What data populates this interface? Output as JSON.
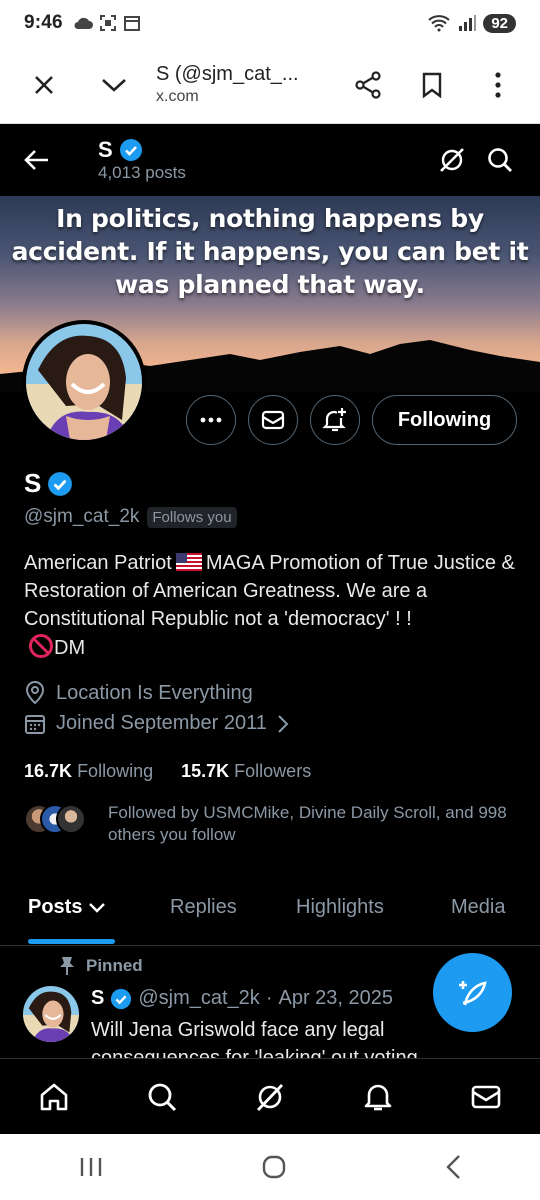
{
  "status_bar": {
    "time": "9:46",
    "battery": "92"
  },
  "browser_tab": {
    "title": "S (@sjm_cat_...",
    "url": "x.com"
  },
  "profile_header": {
    "name": "S",
    "posts_count": "4,013 posts"
  },
  "banner": {
    "quote": "In politics, nothing happens by accident. If it happens, you can bet it was planned that way."
  },
  "profile": {
    "name": "S",
    "handle": "@sjm_cat_2k",
    "follows_you_badge": "Follows you",
    "follow_button_label": "Following",
    "bio_part1": "American Patriot",
    "bio_part2": "MAGA    Promotion of True Justice & Restoration of American Greatness.    We are a Constitutional Republic not a 'democracy' ! !",
    "bio_part3": "DM",
    "location": "Location Is Everything",
    "joined": "Joined September 2011",
    "following_count": "16.7K",
    "following_label": "Following",
    "followers_count": "15.7K",
    "followers_label": "Followers",
    "followed_by": "Followed by USMCMike, Divine Daily Scroll, and 998 others you follow"
  },
  "tabs": {
    "posts": "Posts",
    "replies": "Replies",
    "highlights": "Highlights",
    "media": "Media"
  },
  "pinned_tweet": {
    "pinned_label": "Pinned",
    "name": "S",
    "handle": "@sjm_cat_2k",
    "separator": "·",
    "date": "Apr 23, 2025",
    "text": "Will Jena Griswold face any legal consequences for 'leaking' out voting"
  },
  "colors": {
    "accent": "#1d9bf0",
    "background": "#000000",
    "secondary_text": "#8b98a5"
  }
}
